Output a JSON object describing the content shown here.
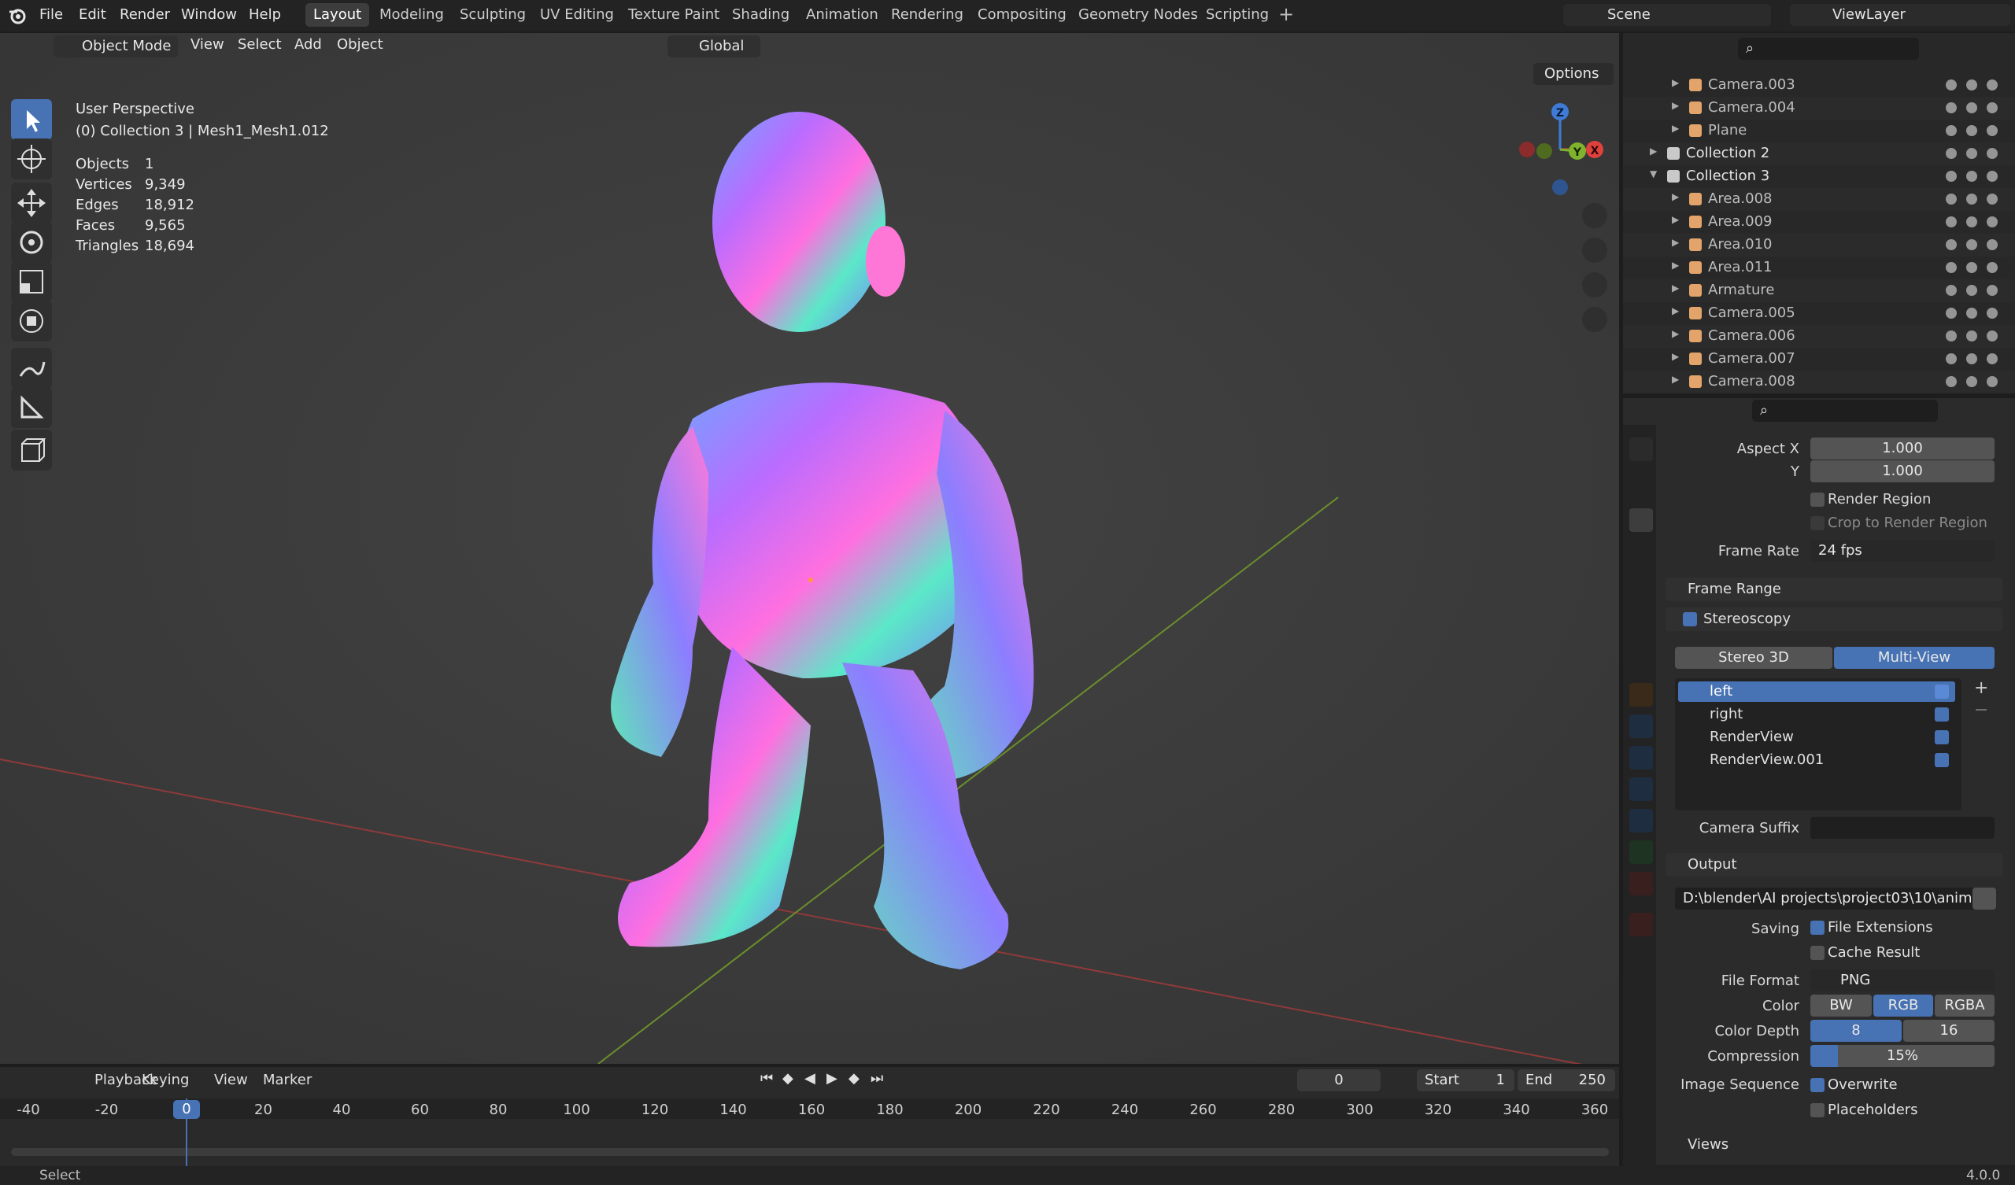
{
  "topbar": {
    "menus": [
      "File",
      "Edit",
      "Render",
      "Window",
      "Help"
    ],
    "workspaces": [
      "Layout",
      "Modeling",
      "Sculpting",
      "UV Editing",
      "Texture Paint",
      "Shading",
      "Animation",
      "Rendering",
      "Compositing",
      "Geometry Nodes",
      "Scripting"
    ],
    "active_workspace": "Layout",
    "scene": "Scene",
    "view_layer": "ViewLayer"
  },
  "viewport_header": {
    "mode": "Object Mode",
    "menus": [
      "View",
      "Select",
      "Add",
      "Object"
    ],
    "orientation": "Global",
    "options": "Options"
  },
  "viewport": {
    "perspective": "User Perspective",
    "context": "(0) Collection 3 | Mesh1_Mesh1.012",
    "stats": [
      {
        "label": "Objects",
        "value": "1"
      },
      {
        "label": "Vertices",
        "value": "9,349"
      },
      {
        "label": "Edges",
        "value": "18,912"
      },
      {
        "label": "Faces",
        "value": "9,565"
      },
      {
        "label": "Triangles",
        "value": "18,694"
      }
    ],
    "gizmo": {
      "x": "X",
      "y": "Y",
      "z": "Z"
    }
  },
  "outliner": {
    "rows": [
      {
        "name": "Camera.003",
        "kind": "camera-icon"
      },
      {
        "name": "Camera.004",
        "kind": "camera-icon"
      },
      {
        "name": "Plane",
        "kind": "mesh-icon"
      },
      {
        "name": "Collection 2",
        "kind": "collection-icon"
      },
      {
        "name": "Collection 3",
        "kind": "collection-icon"
      },
      {
        "name": "Area.008",
        "kind": "light-icon"
      },
      {
        "name": "Area.009",
        "kind": "light-icon"
      },
      {
        "name": "Area.010",
        "kind": "light-icon"
      },
      {
        "name": "Area.011",
        "kind": "light-icon"
      },
      {
        "name": "Armature",
        "kind": "armature-icon"
      },
      {
        "name": "Camera.005",
        "kind": "camera-icon"
      },
      {
        "name": "Camera.006",
        "kind": "camera-icon"
      },
      {
        "name": "Camera.007",
        "kind": "camera-icon"
      },
      {
        "name": "Camera.008",
        "kind": "camera-icon"
      }
    ]
  },
  "properties": {
    "aspect_x_label": "Aspect X",
    "aspect_x": "1.000",
    "aspect_y_label": "Y",
    "aspect_y": "1.000",
    "render_region": "Render Region",
    "crop_region": "Crop to Render Region",
    "frame_rate_label": "Frame Rate",
    "frame_rate": "24 fps",
    "frame_range": "Frame Range",
    "stereoscopy": "Stereoscopy",
    "stereo_3d": "Stereo 3D",
    "multi_view": "Multi-View",
    "views": [
      "left",
      "right",
      "RenderView",
      "RenderView.001"
    ],
    "camera_suffix_label": "Camera Suffix",
    "output": "Output",
    "output_path": "D:\\blender\\AI projects\\project03\\10\\anima...",
    "saving_label": "Saving",
    "file_extensions": "File Extensions",
    "cache_result": "Cache Result",
    "file_format_label": "File Format",
    "file_format": "PNG",
    "color_label": "Color",
    "color_options": [
      "BW",
      "RGB",
      "RGBA"
    ],
    "color_depth_label": "Color Depth",
    "color_depth_options": [
      "8",
      "16"
    ],
    "compression_label": "Compression",
    "compression": "15%",
    "compression_level": 0.15,
    "image_sequence_label": "Image Sequence",
    "overwrite": "Overwrite",
    "placeholders": "Placeholders",
    "views_panel": "Views"
  },
  "timeline": {
    "menus": [
      "Playback",
      "Keying",
      "View",
      "Marker"
    ],
    "current_frame": "0",
    "start_label": "Start",
    "start": "1",
    "end_label": "End",
    "end": "250",
    "ticks": [
      "-40",
      "-20",
      "0",
      "20",
      "40",
      "60",
      "80",
      "100",
      "120",
      "140",
      "160",
      "180",
      "200",
      "220",
      "240",
      "260",
      "280",
      "300",
      "320",
      "340",
      "360"
    ]
  },
  "statusbar": {
    "left": "Select",
    "version": "4.0.0"
  }
}
